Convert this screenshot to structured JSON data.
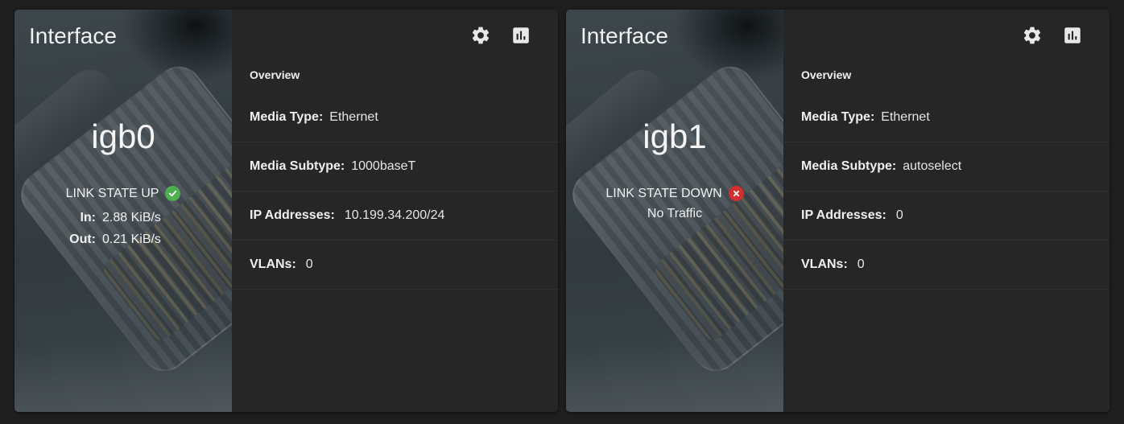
{
  "cards": [
    {
      "title": "Interface",
      "name": "igb0",
      "link_state": "LINK STATE UP",
      "link_status": "up",
      "traffic": {
        "in_label": "In:",
        "in_value": "2.88 KiB/s",
        "out_label": "Out:",
        "out_value": "0.21 KiB/s"
      },
      "actions": {
        "settings_icon": "gear-icon",
        "stats_icon": "bar-chart-icon"
      },
      "overview_title": "Overview",
      "media_type_label": "Media Type:",
      "media_type": "Ethernet",
      "media_subtype_label": "Media Subtype:",
      "media_subtype": "1000baseT",
      "ip_label": "IP Addresses:",
      "ip": "10.199.34.200/24",
      "vlans_label": "VLANs:",
      "vlans": "0"
    },
    {
      "title": "Interface",
      "name": "igb1",
      "link_state": "LINK STATE DOWN",
      "link_status": "down",
      "no_traffic": "No Traffic",
      "actions": {
        "settings_icon": "gear-icon",
        "stats_icon": "bar-chart-icon"
      },
      "overview_title": "Overview",
      "media_type_label": "Media Type:",
      "media_type": "Ethernet",
      "media_subtype_label": "Media Subtype:",
      "media_subtype": "autoselect",
      "ip_label": "IP Addresses:",
      "ip": "0",
      "vlans_label": "VLANs:",
      "vlans": "0"
    }
  ],
  "colors": {
    "status_up": "#4caf50",
    "status_down": "#d32f2f",
    "card_bg": "#262626",
    "page_bg": "#1e1e1e"
  }
}
